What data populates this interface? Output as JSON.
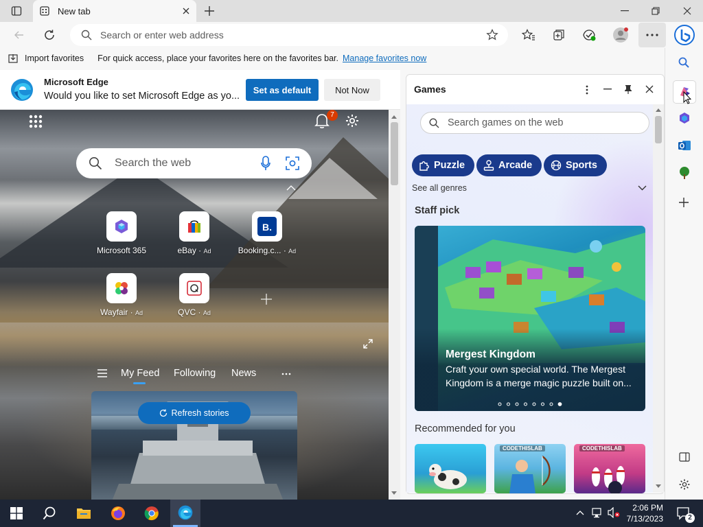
{
  "browser": {
    "tab": {
      "title": "New tab"
    },
    "address_bar": {
      "placeholder": "Search or enter web address"
    },
    "favorites_bar": {
      "import_label": "Import favorites",
      "hint": "For quick access, place your favorites here on the favorites bar.",
      "manage_link": "Manage favorites now"
    }
  },
  "default_banner": {
    "title": "Microsoft Edge",
    "message": "Would you like to set Microsoft Edge as yo...",
    "primary_button": "Set as default",
    "secondary_button": "Not Now"
  },
  "new_tab_page": {
    "notification_count": "7",
    "search_placeholder": "Search the web",
    "quick_links": [
      {
        "label": "Microsoft 365",
        "ad": ""
      },
      {
        "label": "eBay",
        "ad": "Ad"
      },
      {
        "label": "Booking.c...",
        "ad": "Ad"
      },
      {
        "label": "Wayfair",
        "ad": "Ad"
      },
      {
        "label": "QVC",
        "ad": "Ad"
      }
    ],
    "feed_tabs": [
      "My Feed",
      "Following",
      "News"
    ],
    "refresh_label": "Refresh stories"
  },
  "games_panel": {
    "title": "Games",
    "search_placeholder": "Search games on the web",
    "genres": [
      "Puzzle",
      "Arcade",
      "Sports"
    ],
    "see_all": "See all genres",
    "staff_pick": {
      "heading": "Staff pick",
      "game_title": "Mergest Kingdom",
      "description": "Craft your own special world. The Mergest Kingdom is a merge magic puzzle built on...",
      "carousel_dots": 8,
      "active_dot": 7
    },
    "recommended": {
      "heading": "Recommended for you",
      "badge": "CODETHISLAB"
    }
  },
  "taskbar": {
    "time": "2:06 PM",
    "date": "7/13/2023",
    "notification_count": "2"
  },
  "colors": {
    "accent": "#0f6cbd",
    "genre_pill": "#1a3a8c",
    "taskbar": "#1d2535",
    "notification_badge": "#d83b01"
  }
}
